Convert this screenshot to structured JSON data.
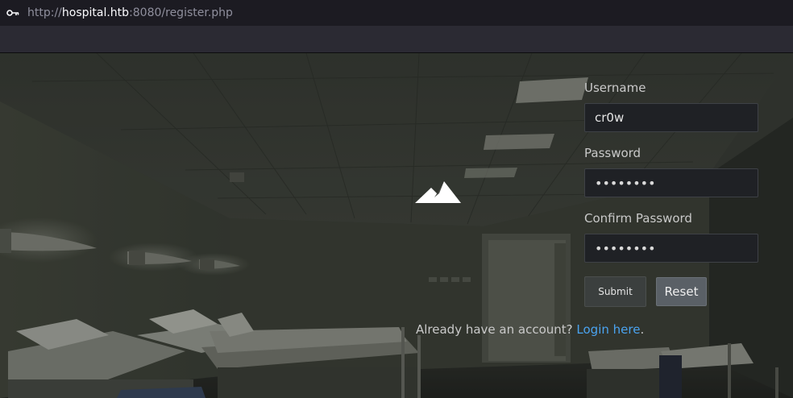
{
  "browser": {
    "url_scheme": "http://",
    "url_host": "hospital.htb",
    "url_rest": ":8080/register.php"
  },
  "form": {
    "username_label": "Username",
    "username_value": "cr0w",
    "password_label": "Password",
    "password_value": "••••••••",
    "confirm_label": "Confirm Password",
    "confirm_value": "••••••••",
    "submit_label": "Submit",
    "reset_label": "Reset"
  },
  "footer": {
    "prompt": "Already have an account?",
    "link": "Login here",
    "period": "."
  },
  "colors": {
    "link": "#4aa3f0",
    "accent_reset": "#5a6066"
  },
  "icons": {
    "url": "key-icon",
    "logo": "mountain-icon"
  }
}
